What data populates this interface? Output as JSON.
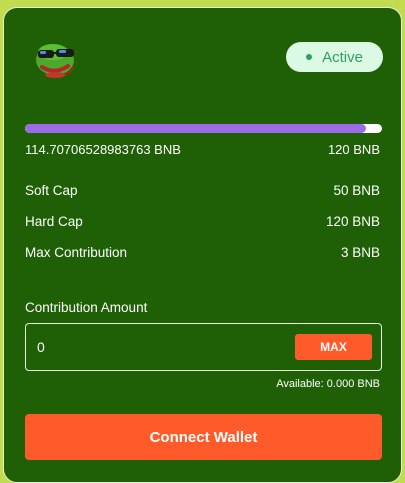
{
  "header": {
    "logo_icon": "pepe-frog-sunglasses-icon",
    "status_badge": "Active"
  },
  "progress": {
    "raised": "114.70706528983763 BNB",
    "cap": "120 BNB",
    "fill_fraction": 0.9559,
    "fill_color": "#9c6be6"
  },
  "stats": [
    {
      "label": "Soft Cap",
      "value": "50 BNB"
    },
    {
      "label": "Hard Cap",
      "value": "120 BNB"
    },
    {
      "label": "Max Contribution",
      "value": "3 BNB"
    }
  ],
  "contribution": {
    "label": "Contribution Amount",
    "input_value": "0",
    "max_label": "MAX",
    "available": "Available: 0.000 BNB"
  },
  "connect_button": "Connect Wallet",
  "colors": {
    "card_bg": "#1f6006",
    "page_bg": "#c3dc4f",
    "accent": "#ff5a2a",
    "badge_bg": "#dcf9e6",
    "badge_text": "#2ca25f"
  }
}
